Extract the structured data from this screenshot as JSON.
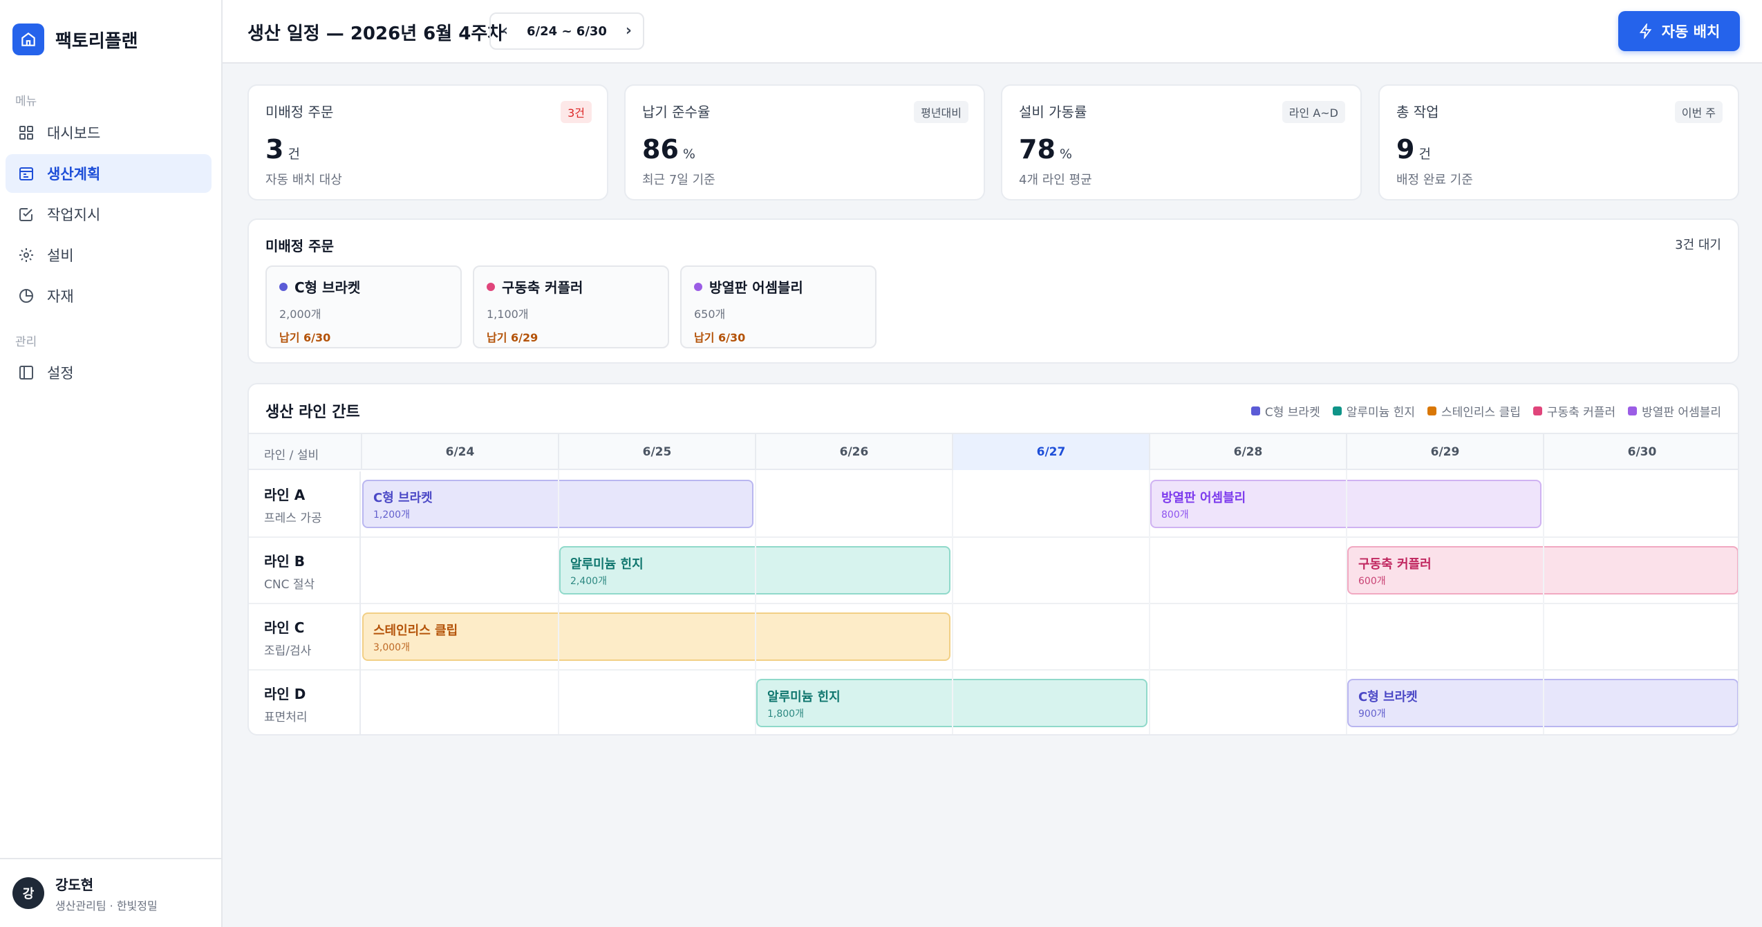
{
  "brand": {
    "name": "팩토리플랜"
  },
  "nav": {
    "menu_label": "메뉴",
    "admin_label": "관리",
    "items": [
      {
        "label": "대시보드",
        "icon": "grid-icon"
      },
      {
        "label": "생산계획",
        "icon": "calendar-icon",
        "active": true
      },
      {
        "label": "작업지시",
        "icon": "checkbox-icon"
      },
      {
        "label": "설비",
        "icon": "gear-icon"
      },
      {
        "label": "자재",
        "icon": "pie-icon"
      }
    ],
    "admin_items": [
      {
        "label": "설정",
        "icon": "layout-icon"
      }
    ]
  },
  "user": {
    "initial": "강",
    "name": "강도현",
    "role": "생산관리팀 · 한빛정밀"
  },
  "header": {
    "title": "생산 일정 — 2026년 6월 4주차",
    "week_range": "6/24 ~ 6/30",
    "auto_button": "자동 배치"
  },
  "stats": [
    {
      "label": "미배정 주문",
      "badge": "3건",
      "badge_style": "red",
      "value": "3",
      "unit": "건",
      "sub": "자동 배치 대상"
    },
    {
      "label": "납기 준수율",
      "badge": "평년대비",
      "badge_style": "gray",
      "value": "86",
      "unit": "%",
      "sub": "최근 7일 기준"
    },
    {
      "label": "설비 가동률",
      "badge": "라인 A~D",
      "badge_style": "gray",
      "value": "78",
      "unit": "%",
      "sub": "4개 라인 평균"
    },
    {
      "label": "총 작업",
      "badge": "이번 주",
      "badge_style": "gray",
      "value": "9",
      "unit": "건",
      "sub": "배정 완료 기준"
    }
  ],
  "orders": {
    "title": "미배정 주문",
    "count": "3건 대기",
    "items": [
      {
        "name": "C형 브라켓",
        "qty": "2,000개",
        "due": "납기 6/30",
        "color": "#5b5bd6"
      },
      {
        "name": "구동축 커플러",
        "qty": "1,100개",
        "due": "납기 6/29",
        "color": "#e0457b"
      },
      {
        "name": "방열판 어셈블리",
        "qty": "650개",
        "due": "납기 6/30",
        "color": "#9b5de5"
      }
    ]
  },
  "gantt": {
    "title": "생산 라인 간트",
    "head_label": "라인 / 설비",
    "legend": [
      {
        "label": "C형 브라켓",
        "color": "#5b5bd6"
      },
      {
        "label": "알루미늄 힌지",
        "color": "#0f9488"
      },
      {
        "label": "스테인리스 클립",
        "color": "#d97706"
      },
      {
        "label": "구동축 커플러",
        "color": "#e0457b"
      },
      {
        "label": "방열판 어셈블리",
        "color": "#9b5de5"
      }
    ],
    "days": [
      "6/24",
      "6/25",
      "6/26",
      "6/27",
      "6/28",
      "6/29",
      "6/30"
    ],
    "today_index": 3,
    "lines": [
      {
        "name": "라인 A",
        "process": "프레스 가공",
        "jobs": [
          {
            "name": "C형 브라켓",
            "qty": "1,200개",
            "start": 0,
            "span": 2,
            "product": 0
          },
          {
            "name": "방열판 어셈블리",
            "qty": "800개",
            "start": 4,
            "span": 2,
            "product": 4
          }
        ]
      },
      {
        "name": "라인 B",
        "process": "CNC 절삭",
        "jobs": [
          {
            "name": "알루미늄 힌지",
            "qty": "2,400개",
            "start": 1,
            "span": 2,
            "product": 1
          },
          {
            "name": "구동축 커플러",
            "qty": "600개",
            "start": 5,
            "span": 2,
            "product": 3
          }
        ]
      },
      {
        "name": "라인 C",
        "process": "조립/검사",
        "jobs": [
          {
            "name": "스테인리스 클립",
            "qty": "3,000개",
            "start": 0,
            "span": 3,
            "product": 2
          }
        ]
      },
      {
        "name": "라인 D",
        "process": "표면처리",
        "jobs": [
          {
            "name": "알루미늄 힌지",
            "qty": "1,800개",
            "start": 2,
            "span": 2,
            "product": 1
          },
          {
            "name": "C형 브라켓",
            "qty": "900개",
            "start": 5,
            "span": 2,
            "product": 0
          }
        ]
      }
    ]
  }
}
